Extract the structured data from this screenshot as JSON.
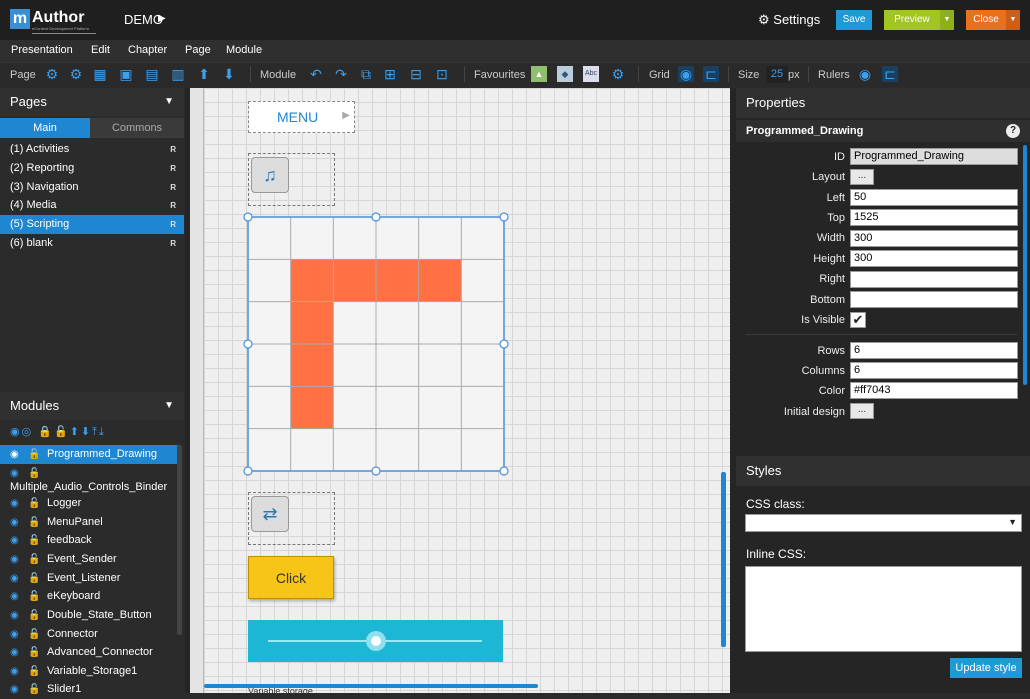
{
  "app": {
    "logo_m": "m",
    "logo_word": "Author",
    "logo_sub": "eContent Development Platform",
    "project": "DEMO",
    "play_icon": "play-icon"
  },
  "header": {
    "settings_label": "Settings",
    "save_label": "Save",
    "preview_label": "Preview",
    "close_label": "Close",
    "colors": {
      "save": "#1f9ad6",
      "preview": "#a2c523",
      "close": "#e8711f"
    }
  },
  "menu": [
    "Presentation",
    "Edit",
    "Chapter",
    "Page",
    "Module"
  ],
  "toolbar": {
    "page_label": "Page",
    "module_label": "Module",
    "favourites_label": "Favourites",
    "grid_label": "Grid",
    "size_label": "Size",
    "size_value": "25",
    "size_unit": "px",
    "rulers_label": "Rulers"
  },
  "pages_panel": {
    "title": "Pages",
    "tabs": [
      "Main",
      "Commons"
    ],
    "items": [
      {
        "label": "(1) Activities",
        "flag": "R"
      },
      {
        "label": "(2) Reporting",
        "flag": "R"
      },
      {
        "label": "(3) Navigation",
        "flag": "R"
      },
      {
        "label": "(4) Media",
        "flag": "R"
      },
      {
        "label": "(5) Scripting",
        "flag": "R"
      },
      {
        "label": "(6) blank",
        "flag": "R"
      }
    ]
  },
  "modules_panel": {
    "title": "Modules",
    "items": [
      "Programmed_Drawing",
      "Multiple_Audio_Controls_Binder",
      "Logger",
      "MenuPanel",
      "feedback",
      "Event_Sender",
      "Event_Listener",
      "eKeyboard",
      "Double_State_Button",
      "Connector",
      "Advanced_Connector",
      "Variable_Storage1",
      "Slider1"
    ]
  },
  "canvas": {
    "menu_label": "MENU",
    "click_label": "Click",
    "variable_storage_label": "Variable storage",
    "drawing": {
      "rows": 6,
      "columns": 6,
      "color": "#ff7043",
      "filled": [
        [
          1,
          1
        ],
        [
          1,
          2
        ],
        [
          1,
          3
        ],
        [
          1,
          4
        ],
        [
          2,
          1
        ],
        [
          3,
          1
        ],
        [
          4,
          1
        ]
      ]
    }
  },
  "properties": {
    "title": "Properties",
    "module_name": "Programmed_Drawing",
    "fields": {
      "id": "Programmed_Drawing",
      "layout": "...",
      "left": "50",
      "top": "1525",
      "width": "300",
      "height": "300",
      "right": "",
      "bottom": "",
      "rows": "6",
      "columns": "6",
      "color": "#ff7043",
      "initial_design": "..."
    },
    "labels": {
      "id": "ID",
      "layout": "Layout",
      "left": "Left",
      "top": "Top",
      "width": "Width",
      "height": "Height",
      "right": "Right",
      "bottom": "Bottom",
      "is_visible": "Is Visible",
      "rows": "Rows",
      "columns": "Columns",
      "color": "Color",
      "initial_design": "Initial design"
    },
    "is_visible": true
  },
  "styles": {
    "title": "Styles",
    "css_class_label": "CSS class:",
    "inline_css_label": "Inline CSS:",
    "update_label": "Update style"
  }
}
